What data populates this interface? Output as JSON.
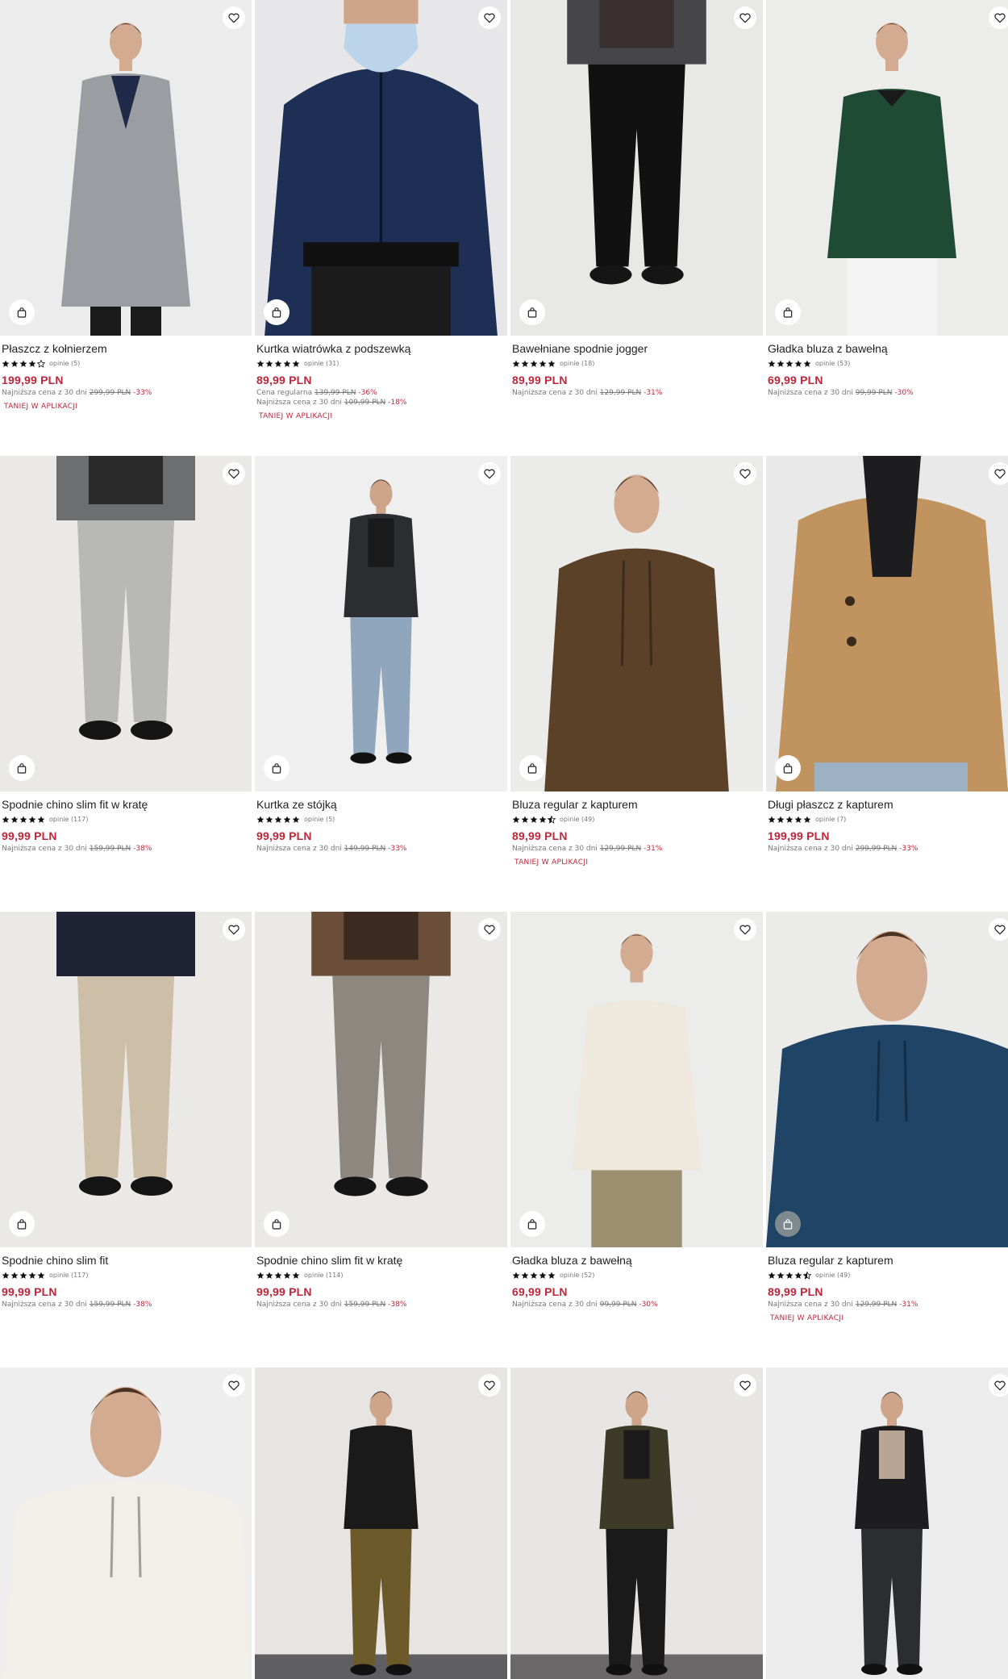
{
  "colors": {
    "accent": "#c0263a",
    "text": "#222222",
    "muted": "#777777",
    "star": "#111111"
  },
  "labels": {
    "lowest_price_prefix": "Najniższa cena z 30 dni",
    "regular_price_prefix": "Cena regularna",
    "app_promo": "TANIEJ W APLIKACJI"
  },
  "products": [
    {
      "name": "Płaszcz z kołnierzem",
      "rating": 4.0,
      "reviews": "opinie (5)",
      "price": "199,99 PLN",
      "regular_price": null,
      "lowest_price": "299,99 PLN",
      "lowest_discount": "-33%",
      "app_promo": true,
      "garment": "coat",
      "colors": {
        "bg": "#ececec",
        "top": "#9a9ea2",
        "inner": "#1f2a48",
        "bottom": "#1a1a1a",
        "skin": "#d3ab90",
        "hair": "#3a2a20"
      }
    },
    {
      "name": "Kurtka wiatrówka z podszewką",
      "rating": 5.0,
      "reviews": "opinie (31)",
      "price": "89,99 PLN",
      "regular_price": "139,99 PLN",
      "regular_discount": "-36%",
      "lowest_price": "109,99 PLN",
      "lowest_discount": "-18%",
      "app_promo": true,
      "garment": "jacket-close",
      "colors": {
        "bg": "#e7e7e9",
        "top": "#1d2f55",
        "inner": "#bcd4ea",
        "bottom": "#1b1b1b",
        "skin": "#cfa58a",
        "hair": "#2e241c"
      }
    },
    {
      "name": "Bawełniane spodnie jogger",
      "rating": 5.0,
      "reviews": "opinie (18)",
      "price": "89,99 PLN",
      "regular_price": null,
      "lowest_price": "129,99 PLN",
      "lowest_discount": "-31%",
      "app_promo": false,
      "garment": "pants",
      "colors": {
        "bg": "#e8e8e6",
        "top": "#46464a",
        "inner": "#3a3032",
        "bottom": "#111111",
        "skin": "#cfa58a",
        "hair": "#2e241c"
      }
    },
    {
      "name": "Gładka bluza z bawełną",
      "rating": 5.0,
      "reviews": "opinie (53)",
      "price": "69,99 PLN",
      "regular_price": null,
      "lowest_price": "99,99 PLN",
      "lowest_discount": "-30%",
      "app_promo": false,
      "garment": "sweater",
      "colors": {
        "bg": "#ececea",
        "top": "#1f4a34",
        "inner": "#1a1a1a",
        "bottom": "#f3f3f3",
        "skin": "#d3ab90",
        "hair": "#5a3d2a"
      }
    },
    {
      "name": "Spodnie chino slim fit w kratę",
      "rating": 5.0,
      "reviews": "opinie (117)",
      "price": "99,99 PLN",
      "regular_price": null,
      "lowest_price": "159,99 PLN",
      "lowest_discount": "-38%",
      "app_promo": false,
      "garment": "pants",
      "colors": {
        "bg": "#ebe9e6",
        "top": "#6d6e70",
        "inner": "#2a2a2a",
        "bottom": "#b8b8b6",
        "skin": "#cfa58a",
        "hair": "#2e241c"
      }
    },
    {
      "name": "Kurtka ze stójką",
      "rating": 5.0,
      "reviews": "opinie (5)",
      "price": "99,99 PLN",
      "regular_price": null,
      "lowest_price": "149,99 PLN",
      "lowest_discount": "-33%",
      "app_promo": false,
      "garment": "full",
      "colors": {
        "bg": "#efefef",
        "top": "#2b2d31",
        "inner": "#1a1a1a",
        "bottom": "#8fa6bd",
        "skin": "#cfa58a",
        "hair": "#3a2a20"
      }
    },
    {
      "name": "Bluza regular z kapturem",
      "rating": 4.5,
      "reviews": "opinie (49)",
      "price": "89,99 PLN",
      "regular_price": null,
      "lowest_price": "129,99 PLN",
      "lowest_discount": "-31%",
      "app_promo": true,
      "garment": "hoodie",
      "colors": {
        "bg": "#ebebea",
        "top": "#5b4128",
        "inner": "#5b4128",
        "bottom": "#5b4128",
        "skin": "#d3ab90",
        "hair": "#4a3324"
      }
    },
    {
      "name": "Długi płaszcz z kapturem",
      "rating": 5.0,
      "reviews": "opinie (7)",
      "price": "199,99 PLN",
      "regular_price": null,
      "lowest_price": "299,99 PLN",
      "lowest_discount": "-33%",
      "app_promo": false,
      "garment": "coat-close",
      "colors": {
        "bg": "#e9e9e9",
        "top": "#c0935f",
        "inner": "#1d1d1f",
        "bottom": "#9cb2c4",
        "skin": "#cfa58a",
        "hair": "#2e241c"
      }
    },
    {
      "name": "Spodnie chino slim fit",
      "rating": 5.0,
      "reviews": "opinie (117)",
      "price": "99,99 PLN",
      "regular_price": null,
      "lowest_price": "159,99 PLN",
      "lowest_discount": "-38%",
      "app_promo": false,
      "garment": "pants",
      "colors": {
        "bg": "#ebe9e6",
        "top": "#1e2436",
        "inner": "#1e2436",
        "bottom": "#cdbfa7",
        "skin": "#cfa58a",
        "hair": "#2e241c"
      }
    },
    {
      "name": "Spodnie chino slim fit w kratę",
      "rating": 5.0,
      "reviews": "opinie (114)",
      "price": "99,99 PLN",
      "regular_price": null,
      "lowest_price": "159,99 PLN",
      "lowest_discount": "-38%",
      "app_promo": false,
      "garment": "pants",
      "colors": {
        "bg": "#ebe9e6",
        "top": "#6a4e3a",
        "inner": "#3a2a20",
        "bottom": "#8d8780",
        "skin": "#cfa58a",
        "hair": "#2e241c"
      }
    },
    {
      "name": "Gładka bluza z bawełną",
      "rating": 5.0,
      "reviews": "opinie (52)",
      "price": "69,99 PLN",
      "regular_price": null,
      "lowest_price": "99,99 PLN",
      "lowest_discount": "-30%",
      "app_promo": false,
      "garment": "sweater",
      "colors": {
        "bg": "#ececea",
        "top": "#efe9dd",
        "inner": "#efe9dd",
        "bottom": "#9b8f70",
        "skin": "#d3ab90",
        "hair": "#5a3d2a"
      }
    },
    {
      "name": "Bluza regular z kapturem",
      "rating": 4.5,
      "reviews": "opinie (49)",
      "price": "89,99 PLN",
      "regular_price": null,
      "lowest_price": "129,99 PLN",
      "lowest_discount": "-31%",
      "app_promo": true,
      "garment": "hoodie-close",
      "colors": {
        "bg": "#ebebea",
        "top": "#1f4466",
        "inner": "#1f4466",
        "bottom": "#1f4466",
        "skin": "#d3ab90",
        "hair": "#4a3324"
      }
    },
    {
      "name": "",
      "rating": null,
      "reviews": "",
      "price": "",
      "garment": "hoodie-close",
      "colors": {
        "bg": "#eeeeee",
        "top": "#f2efe8",
        "inner": "#f2efe8",
        "bottom": "#f2efe8",
        "skin": "#d3ab90",
        "hair": "#4a3324"
      }
    },
    {
      "name": "",
      "rating": null,
      "reviews": "",
      "price": "",
      "garment": "full",
      "colors": {
        "bg": "#e8e4e2",
        "top": "#1a1a1a",
        "inner": "#1a1a1a",
        "bottom": "#6c5a2a",
        "skin": "#cfa58a",
        "hair": "#2e241c",
        "floor": "#5f5e60"
      }
    },
    {
      "name": "",
      "rating": null,
      "reviews": "",
      "price": "",
      "garment": "full",
      "colors": {
        "bg": "#e8e6e4",
        "top": "#3e3a28",
        "inner": "#1a1a1a",
        "bottom": "#1a1a1a",
        "skin": "#cfa58a",
        "hair": "#2e241c",
        "floor": "#6a6869"
      }
    },
    {
      "name": "",
      "rating": null,
      "reviews": "",
      "price": "",
      "garment": "full",
      "colors": {
        "bg": "#ececec",
        "top": "#1d1d1f",
        "inner": "#b8a594",
        "bottom": "#2b2d31",
        "skin": "#cfa58a",
        "hair": "#3a2a20"
      }
    }
  ]
}
